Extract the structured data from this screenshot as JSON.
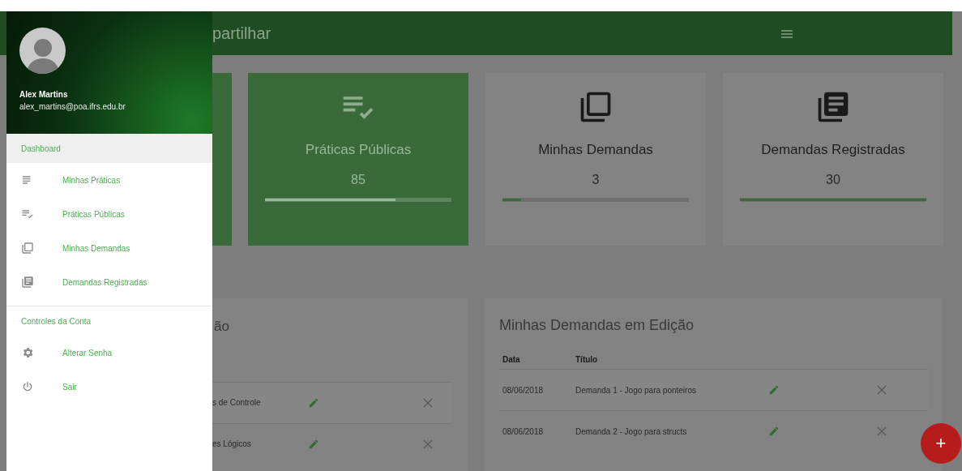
{
  "app_bar": {
    "title": "partilhar"
  },
  "drawer": {
    "user": {
      "name": "Alex Martins",
      "email": "alex_martins@poa.ifrs.edu.br"
    },
    "sections": [
      {
        "header": "Dashboard",
        "selected": true,
        "items": [
          {
            "label": "Minhas Práticas"
          },
          {
            "label": "Práticas Públicas"
          },
          {
            "label": "Minhas Demandas"
          },
          {
            "label": "Demandas Registradas"
          }
        ]
      },
      {
        "header": "Controles da Conta",
        "selected": false,
        "items": [
          {
            "label": "Alterar Senha"
          },
          {
            "label": "Sair"
          }
        ]
      }
    ]
  },
  "cards": [
    {
      "title": "Práticas Públicas",
      "value": "85",
      "level": 0.7,
      "highlighted": true
    },
    {
      "title": "Minhas Demandas",
      "value": "3",
      "level": 0.1,
      "highlighted": false
    },
    {
      "title": "Demandas Registradas",
      "value": "30",
      "level": 1.0,
      "highlighted": false
    }
  ],
  "left_panel": {
    "title": "ão",
    "rows": [
      {
        "title": "s de Controle"
      },
      {
        "title": "es Lógicos"
      }
    ]
  },
  "right_panel": {
    "title": "Minhas Demandas em Edição",
    "columns": [
      "Data",
      "Título"
    ],
    "rows": [
      {
        "date": "08/06/2018",
        "title": "Demanda 1 - Jogo para ponteiros"
      },
      {
        "date": "08/06/2018",
        "title": "Demanda 2 - Jogo para structs"
      }
    ]
  },
  "fab": {
    "label": "+"
  }
}
